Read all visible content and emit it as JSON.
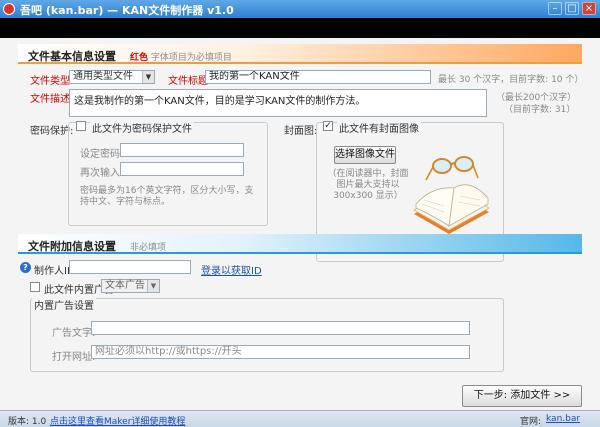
{
  "window": {
    "title": "吾吧 (kan.bar) — KAN文件制作器 v1.0",
    "min": "–",
    "max": "□",
    "close": "×"
  },
  "section1": {
    "title": "文件基本信息设置",
    "note_red": "红色",
    "note_rest": "字体项目为必填项目",
    "file_type_label": "文件类型:",
    "file_type_value": "通用类型文件",
    "file_title_label": "文件标题:",
    "file_title_value": "我的第一个KAN文件",
    "file_title_hint": "最长 30 个汉字，目前字数: 10 个）",
    "file_desc_label": "文件描述:",
    "file_desc_value": "这是我制作的第一个KAN文件，目的是学习KAN文件的制作方法。",
    "file_desc_hint1": "（最长200个汉字）",
    "file_desc_hint2": "（目前字数: 31）",
    "pwd_label": "密码保护:",
    "pwd_checkbox": "此文件为密码保护文件",
    "pwd_set_label": "设定密码:",
    "pwd_confirm_label": "再次输入:",
    "pwd_hint": "密码最多为16个英文字符，区分大小写，支持中文、字符与标点。",
    "cover_label": "封面图:",
    "cover_checkbox": "此文件有封面图像",
    "cover_checked": "✓",
    "cover_button": "选择图像文件",
    "cover_hint": "（在阅读器中，封面图片最大支持以 300x300 显示）"
  },
  "section2": {
    "title": "文件附加信息设置",
    "note": "非必填项",
    "author_label": "制作人ID:",
    "author_value": "",
    "author_link": "登录以获取ID",
    "ad_checkbox": "此文件内置广告",
    "ad_type_value": "文本广告",
    "ad_group_title": "内置广告设置",
    "ad_text_label": "广告文字:",
    "ad_text_value": "",
    "ad_url_label": "打开网址:",
    "ad_url_placeholder": "网址必须以http://或https://开头"
  },
  "next_button": "下一步: 添加文件 >>",
  "statusbar": {
    "version": "版本: 1.0",
    "help_link": "点击这里查看Maker详细使用教程",
    "site_label": "官网:",
    "site_link": "kan.bar"
  },
  "colors": {
    "required": "#dd0000",
    "section1_accent": "#f39c3c",
    "section2_accent": "#2c9ad6",
    "link": "#1a4fb8"
  }
}
